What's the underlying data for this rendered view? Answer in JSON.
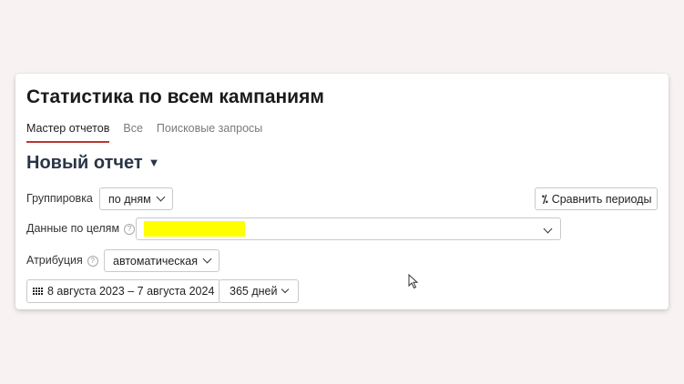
{
  "page_title": "Статистика по всем кампаниям",
  "tabs": [
    {
      "label": "Мастер отчетов",
      "active": true
    },
    {
      "label": "Все",
      "active": false
    },
    {
      "label": "Поисковые запросы",
      "active": false
    }
  ],
  "report_title": "Новый отчет",
  "report_caret": "▼",
  "grouping": {
    "label": "Группировка",
    "value": "по дням"
  },
  "compare": {
    "label": "Сравнить периоды",
    "icon": "compare-periods-icon"
  },
  "goals": {
    "label": "Данные по целям",
    "help": "?",
    "value": "",
    "redaction_color": "#ffff00"
  },
  "attribution": {
    "label": "Атрибуция",
    "help": "?",
    "value": "автоматическая"
  },
  "date_range": {
    "value": "8 августа 2023 – 7 августа 2024",
    "icon": "calendar-icon"
  },
  "period": {
    "value": "365 дней"
  },
  "colors": {
    "accent_underline": "#b9372e",
    "report_title": "#2a3647",
    "background": "#f8f3f2"
  }
}
